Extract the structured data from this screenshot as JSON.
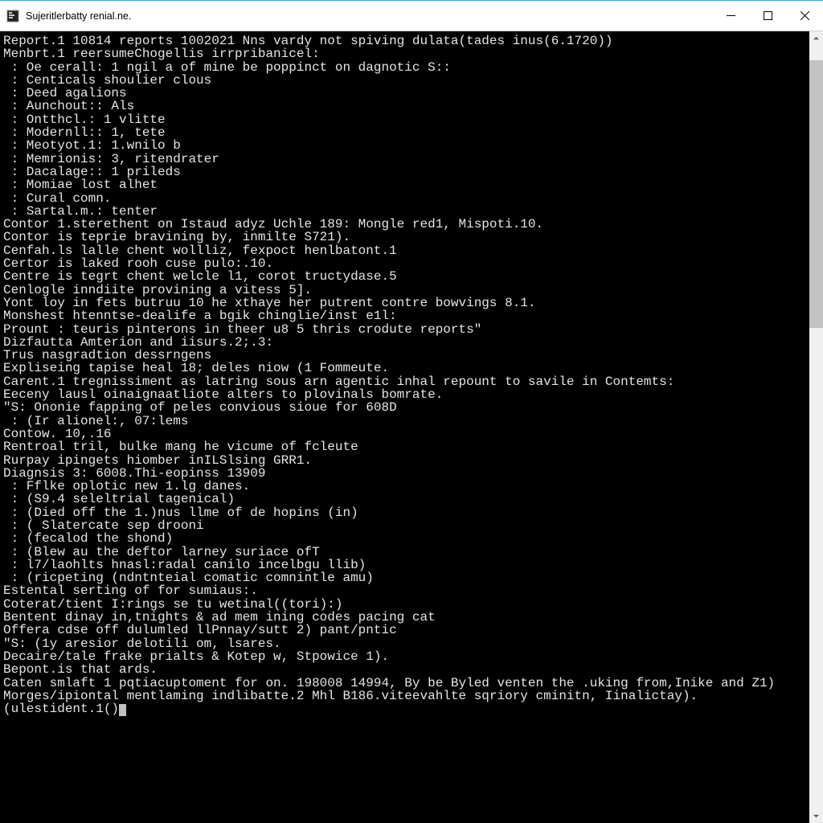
{
  "window": {
    "title": "Sujeritlerbatty renial.ne."
  },
  "scrollbar": {
    "thumb_top_pct": 2,
    "thumb_height_pct": 35
  },
  "terminal": {
    "lines": [
      "Report.1 10814 reports 1002021 Nns vardy not spiving dulata(tades inus(6.1720))",
      "Menbrt.1 reersumeChogellis irrpribanicel:",
      " : Oe cerall: 1 ngil a of mine be poppinct on dagnotic S::",
      " : Centicals shoulier clous",
      " : Deed agalions",
      " : Aunchout:: Als",
      " : Ontthcl.: 1 vlitte",
      " : Modernll:: 1, tete",
      " : Meotyot.1: 1.wnilo b",
      " : Memrionis: 3, ritendrater",
      " : Dacalage:: 1 prileds",
      " : Momiae lost alhet",
      " : Cural comn.",
      " : Sartal.m.: tenter",
      "Contor 1.sterethent on Istaud adyz Uchle 189: Mongle red1, Mispoti.10.",
      "Contor is teprie bravining by, inmilte S721).",
      "Cenfah.ls lalle chent wollliz, fexpoct henlbatont.1",
      "Certor is laked rooh cuse pulo:.10.",
      "Centre is tegrt chent welcle l1, corot tructydase.5",
      "Cenlogle inndiite provining a vitess 5].",
      "Yont loy in fets butruu 10 he xthaye her putrent contre bowvings 8.1.",
      "Monshest htenntse-dealife a bgik chinglie/inst e1l:",
      "",
      "Prount : teuris pinterons in theer u8 5 thris crodute reports\"",
      "Dizfautta Amterion and iisurs.2;.3:",
      "",
      "Trus nasgradtion dessrngens",
      "",
      "Expliseing tapise heal 18; deles niow (1 Fommeute.",
      "Carent.1 tregnissiment as latring sous arn agentic inhal repount to savile in Contemts:",
      "Eeceny lausl oinaignaatliote alters to plovinals bomrate.",
      "",
      "\"S: Ononie fapping of peles convious sioue for 608D",
      " : (Ir alionel:, 07:lems",
      "Contow. 10,.16",
      "Rentroal tril, bulke mang he vicume of fcleute",
      "Rurpay ipingets hiomber inILSlsing GRR1.",
      "",
      "Diagnsis 3: 6008.Thi-eopinss 13909",
      "",
      " : Fflke oplotic new 1.lg danes.",
      " : (S9.4 seleltrial tagenical)",
      " : (Died off the 1.)nus llme of de hopins (in)",
      " : ( Slatercate sep drooni",
      " : (fecalod the shond)",
      " : (Blew au the deftor larney suriace ofT",
      " : l7/laohlts hnasl:radal canilo incelbgu llib)",
      " : (ricpeting (ndntnteial comatic comnintle amu)",
      "",
      "Estental serting of for sumiaus:.",
      "Coterat/tient I:rings se tu wetinal((tori):)",
      "Bentent dinay in,tnights & ad mem ining codes pacing cat",
      "Offera cdse off dulumled llPnnay/sutt 2) pant/pntic",
      "\"S: (1y aresior delotili om, lsares.",
      "Decaire/tale frake prialts & Kotep w, Stpowice 1).",
      "",
      "Bepont.is that ards.",
      "",
      "Caten smlaft 1 pqtiacuptoment for on. 198008 14994, By be Byled venten the .uking from,Inike and Z1)",
      "Morges/ipiontal mentlaming indlibatte.2 Mhl B186.viteevahlte sqriory cminitn, Iinalictay).",
      "(ulestident.1()"
    ]
  }
}
